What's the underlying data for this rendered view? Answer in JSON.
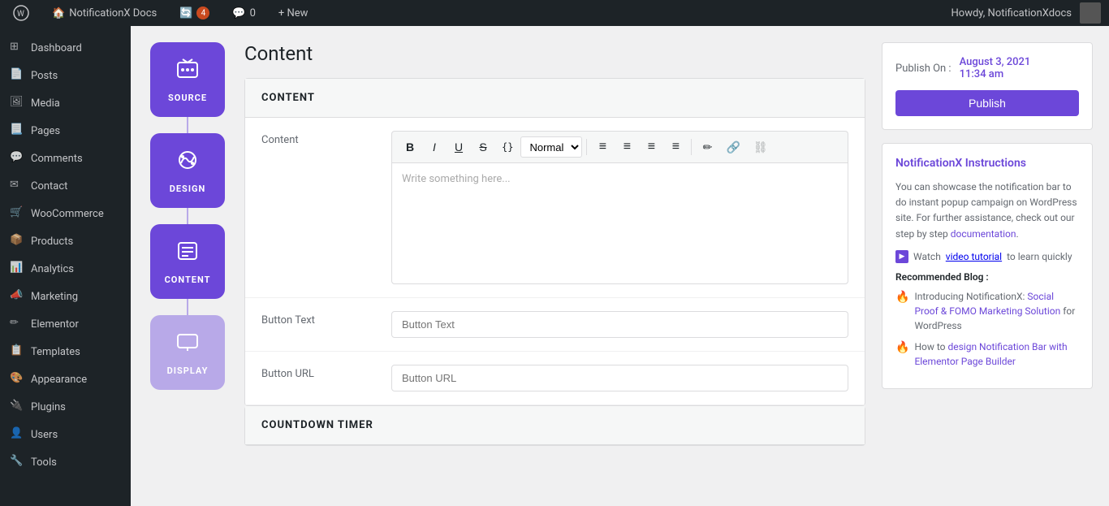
{
  "adminbar": {
    "wp_label": "WP",
    "site_name": "NotificationX Docs",
    "updates_count": "4",
    "comments_count": "0",
    "new_label": "+ New",
    "howdy": "Howdy, NotificationXdocs"
  },
  "sidebar": {
    "items": [
      {
        "id": "dashboard",
        "label": "Dashboard",
        "icon": "⊞"
      },
      {
        "id": "posts",
        "label": "Posts",
        "icon": "📄"
      },
      {
        "id": "media",
        "label": "Media",
        "icon": "🖼"
      },
      {
        "id": "pages",
        "label": "Pages",
        "icon": "📃"
      },
      {
        "id": "comments",
        "label": "Comments",
        "icon": "💬"
      },
      {
        "id": "contact",
        "label": "Contact",
        "icon": "✉"
      },
      {
        "id": "woocommerce",
        "label": "WooCommerce",
        "icon": "🛒"
      },
      {
        "id": "products",
        "label": "Products",
        "icon": "📦"
      },
      {
        "id": "analytics",
        "label": "Analytics",
        "icon": "📊"
      },
      {
        "id": "marketing",
        "label": "Marketing",
        "icon": "📣"
      },
      {
        "id": "elementor",
        "label": "Elementor",
        "icon": "✏"
      },
      {
        "id": "templates",
        "label": "Templates",
        "icon": "📋"
      },
      {
        "id": "appearance",
        "label": "Appearance",
        "icon": "🎨"
      },
      {
        "id": "plugins",
        "label": "Plugins",
        "icon": "🔌"
      },
      {
        "id": "users",
        "label": "Users",
        "icon": "👤"
      },
      {
        "id": "tools",
        "label": "Tools",
        "icon": "🔧"
      }
    ]
  },
  "wizard": {
    "steps": [
      {
        "id": "source",
        "label": "SOURCE",
        "active": true,
        "icon": "⧉"
      },
      {
        "id": "design",
        "label": "DESIGN",
        "active": true,
        "icon": "🎨"
      },
      {
        "id": "content",
        "label": "CONTENT",
        "active": true,
        "icon": "☰"
      },
      {
        "id": "display",
        "label": "DISPLAY",
        "active": false,
        "icon": "🖥"
      }
    ]
  },
  "page": {
    "title": "Content",
    "sections": [
      {
        "id": "content-section",
        "header": "CONTENT",
        "fields": [
          {
            "id": "content-field",
            "label": "Content",
            "type": "editor",
            "placeholder": "Write something here..."
          },
          {
            "id": "button-text-field",
            "label": "Button Text",
            "type": "text",
            "placeholder": "Button Text"
          },
          {
            "id": "button-url-field",
            "label": "Button URL",
            "type": "text",
            "placeholder": "Button URL"
          }
        ]
      },
      {
        "id": "countdown-section",
        "header": "COUNTDOWN TIMER"
      }
    ],
    "toolbar": {
      "bold": "B",
      "italic": "I",
      "underline": "U",
      "strikethrough": "S",
      "code": "{}",
      "format_label": "Normal",
      "align_left": "≡",
      "align_center": "≡",
      "align_right": "≡",
      "align_justify": "≡",
      "pencil": "✏",
      "link": "🔗",
      "unlink": "⛓"
    }
  },
  "publish": {
    "label": "Publish On :",
    "date": "August 3, 2021",
    "time": "11:34 am",
    "button_label": "Publish"
  },
  "instructions": {
    "title": "NotificationX Instructions",
    "body": "You can showcase the notification bar to do instant popup campaign on WordPress site. For further assistance, check out our step by step ",
    "doc_link_text": "documentation",
    "doc_link": "#",
    "watch_text": "Watch ",
    "video_link_text": "video tutorial",
    "video_link": "#",
    "watch_suffix": " to learn quickly",
    "recommended_label": "Recommended Blog :",
    "blogs": [
      {
        "id": "blog1",
        "emoji": "🔥",
        "text": "Introducing NotificationX: ",
        "link_text": "Social Proof & FOMO Marketing Solution",
        "link": "#",
        "suffix": " for WordPress"
      },
      {
        "id": "blog2",
        "emoji": "🔥",
        "text": "How to ",
        "link_text": "design Notification Bar with Elementor Page Builder",
        "link": "#",
        "suffix": ""
      }
    ]
  }
}
